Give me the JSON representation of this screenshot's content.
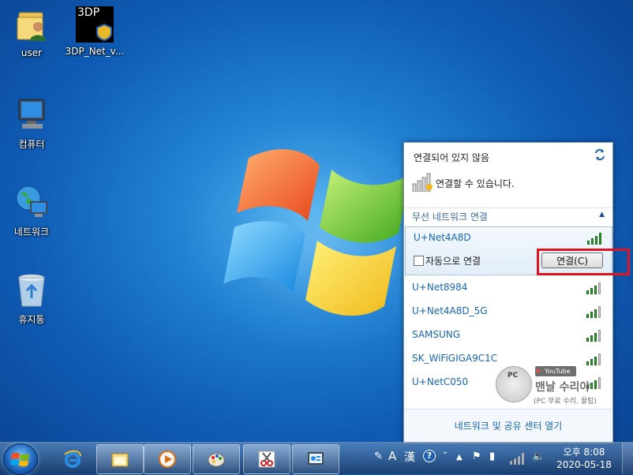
{
  "desktop": {
    "icons": [
      {
        "label": "user",
        "icon": "user-folder-icon"
      },
      {
        "label": "3DP_Net_v...",
        "icon": "3dp-app-icon",
        "badge": "3DP"
      },
      {
        "label": "컴퓨터",
        "icon": "computer-icon"
      },
      {
        "label": "네트워크",
        "icon": "network-globe-icon"
      },
      {
        "label": "휴지통",
        "icon": "recycle-bin-icon"
      }
    ]
  },
  "flyout": {
    "title": "연결되어 있지 않음",
    "status": "연결할 수 있습니다.",
    "section_label": "무선 네트워크 연결",
    "selected": {
      "name": "U+Net4A8D",
      "signal_bars": 4,
      "auto_connect_label": "자동으로 연결",
      "auto_connect_checked": false,
      "connect_label": "연결(C)"
    },
    "networks": [
      {
        "name": "U+Net8984",
        "signal_bars": 3
      },
      {
        "name": "U+Net4A8D_5G",
        "signal_bars": 3
      },
      {
        "name": "SAMSUNG",
        "signal_bars": 3
      },
      {
        "name": "SK_WiFiGIGA9C1C",
        "signal_bars": 3
      },
      {
        "name": "U+NetC050",
        "signal_bars": 3
      }
    ],
    "footer_link": "네트워크 및 공유 센터 열기"
  },
  "watermark": {
    "pc": "PC",
    "youtube": "YouTube",
    "title": "맨날 수리야",
    "subtitle": "(PC 무료 수리, 꿀팁)"
  },
  "taskbar": {
    "apps": [
      "internet-explorer-icon",
      "file-explorer-icon",
      "media-player-icon",
      "paint-icon",
      "snipping-tool-icon",
      "control-panel-icon"
    ],
    "tray": {
      "ime_a": "A",
      "ime_han": "漢",
      "help": "?"
    },
    "clock": {
      "time": "오후 8:08",
      "date": "2020-05-18"
    }
  },
  "colors": {
    "accent": "#1666b5",
    "highlight": "#e0141e"
  }
}
